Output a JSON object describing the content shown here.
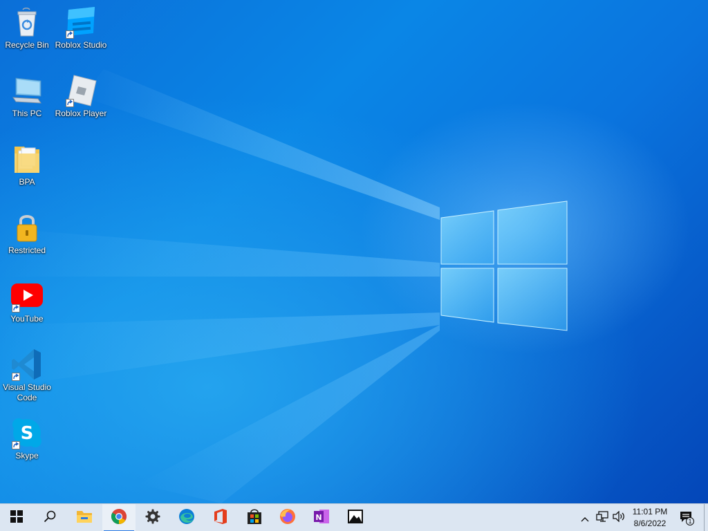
{
  "desktop": {
    "icons": [
      {
        "label": "Recycle Bin",
        "icon": "recycle-bin-icon"
      },
      {
        "label": "Roblox Studio",
        "icon": "roblox-studio-icon"
      },
      {
        "label": "This PC",
        "icon": "computer-icon"
      },
      {
        "label": "Roblox Player",
        "icon": "roblox-player-icon"
      },
      {
        "label": "BPA",
        "icon": "folder-icon"
      },
      {
        "label": "Restricted",
        "icon": "padlock-icon"
      },
      {
        "label": "YouTube",
        "icon": "youtube-icon"
      },
      {
        "label": "Visual Studio Code",
        "icon": "vscode-icon"
      },
      {
        "label": "Skype",
        "icon": "skype-icon"
      }
    ]
  },
  "taskbar": {
    "pinned": [
      {
        "name": "start",
        "icon": "windows-start-icon"
      },
      {
        "name": "search",
        "icon": "search-icon"
      },
      {
        "name": "file-explorer",
        "icon": "folder-icon"
      },
      {
        "name": "chrome",
        "icon": "chrome-icon",
        "active": true
      },
      {
        "name": "settings",
        "icon": "gear-icon"
      },
      {
        "name": "edge",
        "icon": "edge-icon"
      },
      {
        "name": "office",
        "icon": "office-icon"
      },
      {
        "name": "microsoft-store",
        "icon": "store-icon"
      },
      {
        "name": "firefox",
        "icon": "firefox-icon"
      },
      {
        "name": "onenote",
        "icon": "onenote-icon"
      },
      {
        "name": "photos",
        "icon": "photos-icon"
      }
    ],
    "tray": {
      "time": "11:01 PM",
      "date": "8/6/2022",
      "notification_count": "1"
    }
  },
  "colors": {
    "taskbar_bg": "#dce6f2",
    "accent": "#2c7be5",
    "wallpaper_main": "#0a86e6"
  }
}
